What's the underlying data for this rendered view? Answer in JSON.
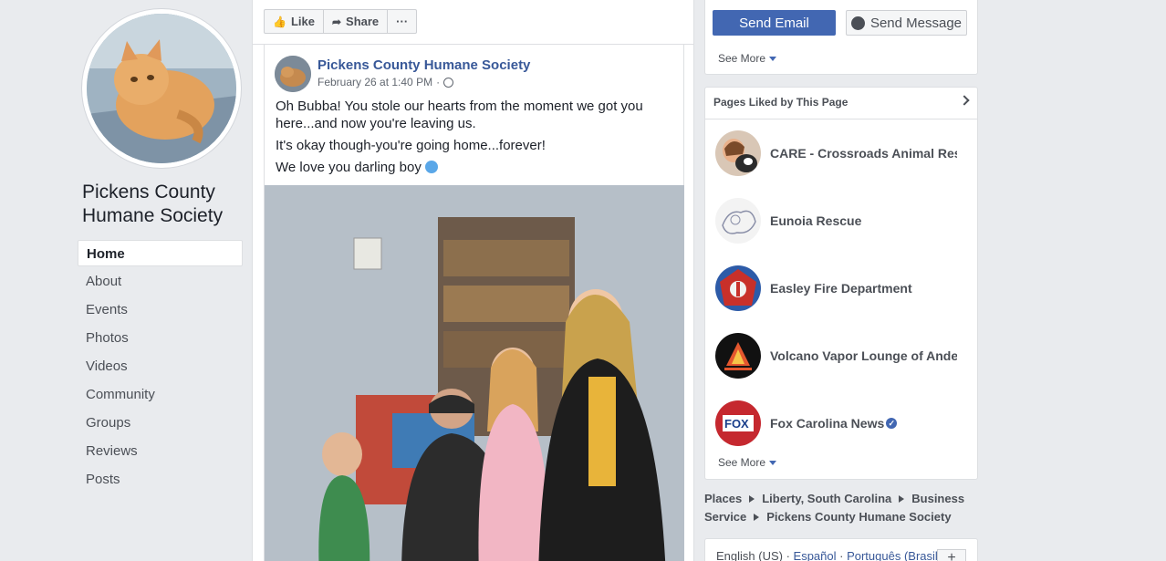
{
  "page": {
    "name": "Pickens County Humane Society"
  },
  "nav": {
    "items": [
      "Home",
      "About",
      "Events",
      "Photos",
      "Videos",
      "Community",
      "Groups",
      "Reviews",
      "Posts"
    ]
  },
  "actions": {
    "like": "Like",
    "share": "Share",
    "more": "···"
  },
  "post": {
    "author": "Pickens County Humane Society",
    "date": "February 26 at 1:40 PM",
    "separator": "·",
    "paragraphs": [
      "Oh Bubba! You stole our hearts from the moment we got you here...and now you're leaving us.",
      "It's okay though-you're going home...forever!",
      "We love you darling boy"
    ]
  },
  "contact": {
    "send_email": "Send Email",
    "send_message": "Send Message",
    "see_more": "See More"
  },
  "liked": {
    "title": "Pages Liked by This Page",
    "items": [
      {
        "name": "CARE - Crossroads Animal Rescue",
        "verified": false
      },
      {
        "name": "Eunoia Rescue",
        "verified": false
      },
      {
        "name": "Easley Fire Department",
        "verified": false
      },
      {
        "name": "Volcano Vapor Lounge of Anderson",
        "verified": false
      },
      {
        "name": "Fox Carolina News",
        "verified": true
      }
    ],
    "see_more": "See More"
  },
  "breadcrumbs": {
    "places": "Places",
    "location": "Liberty, South Carolina",
    "category": "Business Service",
    "page": "Pickens County Humane Society"
  },
  "languages": {
    "current": "English (US)",
    "sep": " · ",
    "other1": "Español",
    "other2": "Português (Brasil)",
    "plus": "+"
  },
  "colors": {
    "brand": "#4267b2",
    "link": "#385898",
    "background": "#e9ebee"
  }
}
